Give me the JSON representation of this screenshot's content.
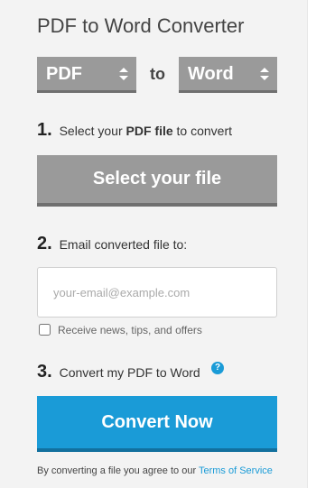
{
  "header": {
    "title": "PDF to Word Converter"
  },
  "format_selector": {
    "from_value": "PDF",
    "to_label": "to",
    "to_value": "Word"
  },
  "step1": {
    "number": "1.",
    "text_before": "Select your",
    "text_bold": "PDF file",
    "text_after": "to convert",
    "button_label": "Select your file"
  },
  "step2": {
    "number": "2.",
    "text": "Email converted file to:",
    "email_placeholder": "your-email@example.com",
    "email_value": "",
    "checkbox_label": "Receive news, tips, and offers"
  },
  "step3": {
    "number": "3.",
    "text": "Convert my PDF to Word",
    "help_icon_glyph": "?",
    "button_label": "Convert Now"
  },
  "footer": {
    "disclaimer_text": "By converting a file you agree to our",
    "terms_link": "Terms of Service"
  },
  "colors": {
    "accent": "#1a9bd7",
    "gray_button": "#9a9a9a",
    "panel_bg": "#f3f3f3"
  }
}
